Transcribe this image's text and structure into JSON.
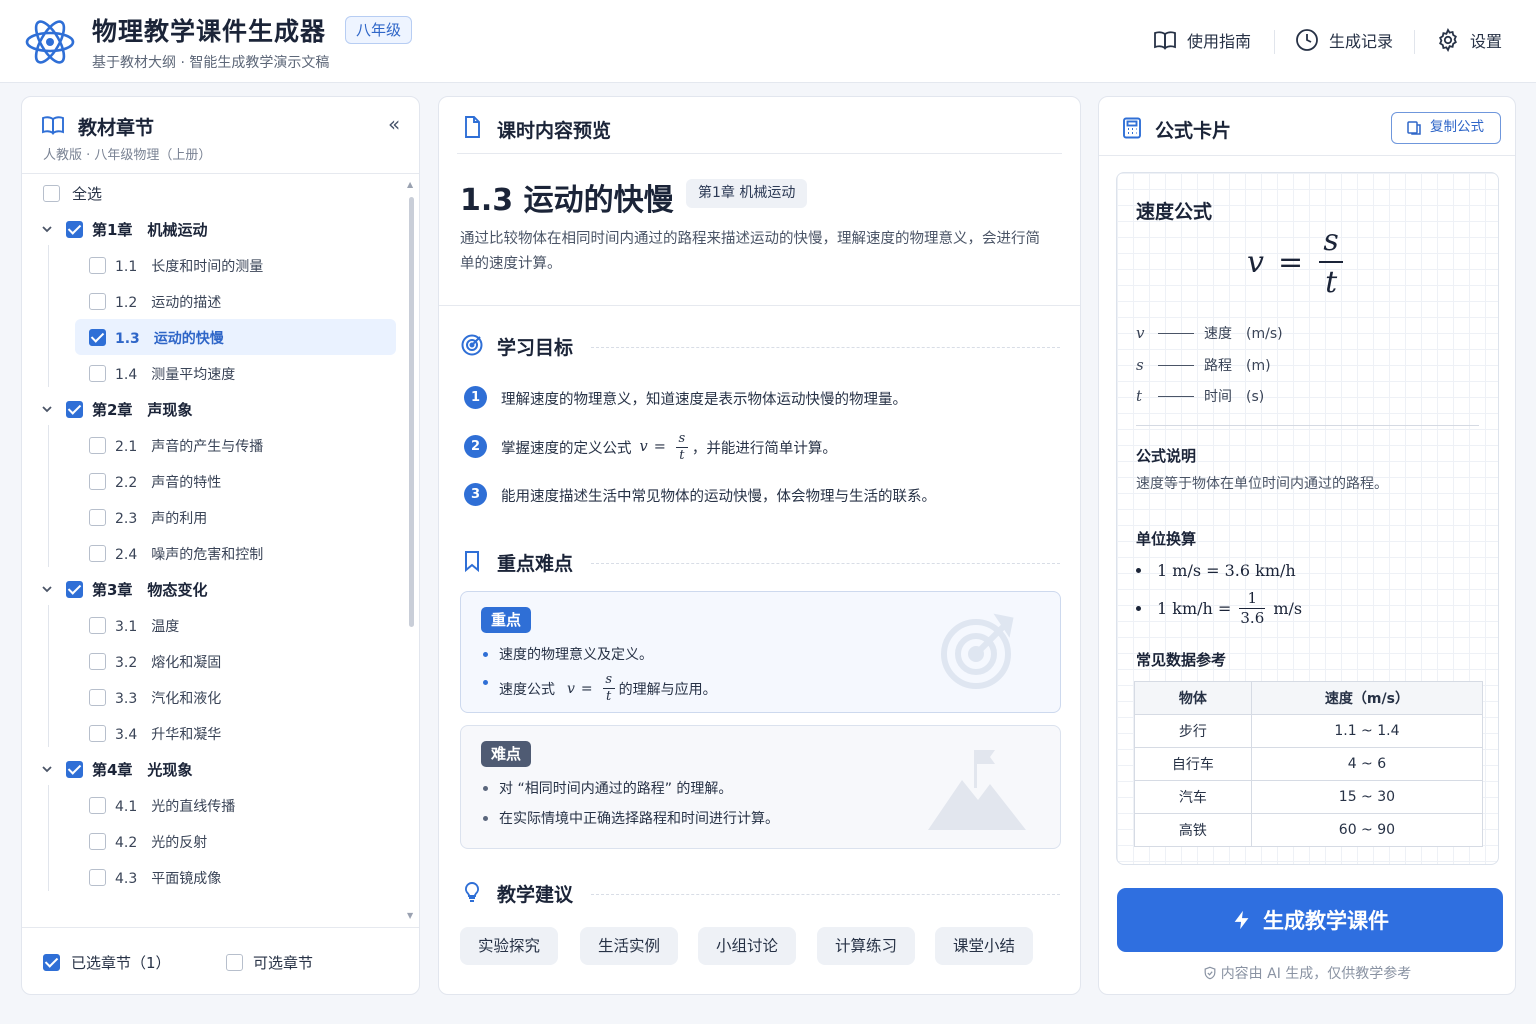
{
  "header": {
    "title": "物理教学课件生成器",
    "grade": "八年级",
    "subtitle": "基于教材大纲 · 智能生成教学演示文稿",
    "nav": [
      {
        "label": "使用指南",
        "icon": "book-icon"
      },
      {
        "label": "生成记录",
        "icon": "clock-icon"
      },
      {
        "label": "设置",
        "icon": "gear-icon"
      }
    ]
  },
  "left": {
    "title": "教材章节",
    "subtitle": "人教版 · 八年级物理（上册）",
    "select_all": "全选",
    "chapters": [
      {
        "label": "第1章　机械运动",
        "checked": true,
        "sections": [
          {
            "no": "1.1",
            "label": "长度和时间的测量",
            "checked": false
          },
          {
            "no": "1.2",
            "label": "运动的描述",
            "checked": false
          },
          {
            "no": "1.3",
            "label": "运动的快慢",
            "checked": true
          },
          {
            "no": "1.4",
            "label": "测量平均速度",
            "checked": false
          }
        ]
      },
      {
        "label": "第2章　声现象",
        "checked": true,
        "sections": [
          {
            "no": "2.1",
            "label": "声音的产生与传播",
            "checked": false
          },
          {
            "no": "2.2",
            "label": "声音的特性",
            "checked": false
          },
          {
            "no": "2.3",
            "label": "声的利用",
            "checked": false
          },
          {
            "no": "2.4",
            "label": "噪声的危害和控制",
            "checked": false
          }
        ]
      },
      {
        "label": "第3章　物态变化",
        "checked": true,
        "sections": [
          {
            "no": "3.1",
            "label": "温度",
            "checked": false
          },
          {
            "no": "3.2",
            "label": "熔化和凝固",
            "checked": false
          },
          {
            "no": "3.3",
            "label": "汽化和液化",
            "checked": false
          },
          {
            "no": "3.4",
            "label": "升华和凝华",
            "checked": false
          }
        ]
      },
      {
        "label": "第4章　光现象",
        "checked": true,
        "sections": [
          {
            "no": "4.1",
            "label": "光的直线传播",
            "checked": false
          },
          {
            "no": "4.2",
            "label": "光的反射",
            "checked": false
          },
          {
            "no": "4.3",
            "label": "平面镜成像",
            "checked": false
          }
        ]
      }
    ],
    "footer": {
      "selected": "已选章节（1）",
      "optional": "可选章节"
    }
  },
  "middle": {
    "title": "课时内容预览",
    "lesson_title": "1.3 运动的快慢",
    "lesson_tag": "第1章 机械运动",
    "lesson_desc": "通过比较物体在相同时间内通过的路程来描述运动的快慢，理解速度的物理意义，会进行简单的速度计算。",
    "goals_title": "学习目标",
    "goals": [
      {
        "num": "1",
        "text": "理解速度的物理意义，知道速度是表示物体运动快慢的物理量。"
      },
      {
        "num": "2",
        "before": "掌握速度的定义公式",
        "var": "v",
        "eq": "=",
        "num_s": "s",
        "den_t": "t",
        "after": "，并能进行简单计算。"
      },
      {
        "num": "3",
        "text": "能用速度描述生活中常见物体的运动快慢，体会物理与生活的联系。"
      }
    ],
    "key_title": "重点难点",
    "key": {
      "label": "重点",
      "items": [
        "速度的物理意义及定义。"
      ],
      "formula_before": "速度公式",
      "formula_after": "的理解与应用。"
    },
    "hard": {
      "label": "难点",
      "items": [
        "对 “相同时间内通过的路程” 的理解。",
        "在实际情境中正确选择路程和时间进行计算。"
      ]
    },
    "tips_title": "教学建议",
    "tips": [
      "实验探究",
      "生活实例",
      "小组讨论",
      "计算练习",
      "课堂小结"
    ]
  },
  "right": {
    "title": "公式卡片",
    "copy": "复制公式",
    "card_title": "速度公式",
    "formula": {
      "lhs": "v",
      "eq": "=",
      "num": "s",
      "den": "t"
    },
    "vars": [
      {
        "sym": "v",
        "desc": "速度　(m/s)"
      },
      {
        "sym": "s",
        "desc": "路程　(m)"
      },
      {
        "sym": "t",
        "desc": "时间　(s)"
      }
    ],
    "explain_title": "公式说明",
    "explain": "速度等于物体在单位时间内通过的路程。",
    "units_title": "单位换算",
    "unit1": "1 m/s = 3.6 km/h",
    "unit2_left": "1 km/h =",
    "unit2_num": "1",
    "unit2_den": "3.6",
    "unit2_right": "m/s",
    "ref_title": "常见数据参考",
    "table": {
      "headers": [
        "物体",
        "速度（m/s）"
      ],
      "rows": [
        [
          "步行",
          "1.1 ~ 1.4"
        ],
        [
          "自行车",
          "4 ~ 6"
        ],
        [
          "汽车",
          "15 ~ 30"
        ],
        [
          "高铁",
          "60 ~ 90"
        ]
      ]
    },
    "generate": "生成教学课件",
    "note": "内容由 AI 生成，仅供教学参考"
  },
  "colors": {
    "accent": "#2f6fd6",
    "button": "#2f6fe0"
  }
}
